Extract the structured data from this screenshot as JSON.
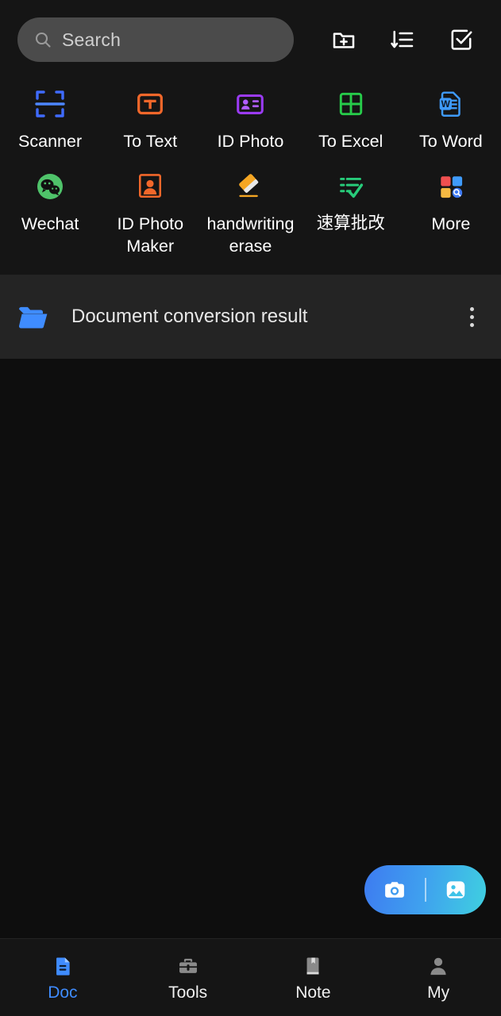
{
  "colors": {
    "background": "#0e0e0e",
    "panel": "#151515",
    "section_bar": "#242424",
    "accent_blue": "#3f8cff",
    "search_field": "#4b4b4b",
    "fab_gradient_start": "#3d7bf0",
    "fab_gradient_end": "#3fd0e0"
  },
  "search": {
    "placeholder": "Search",
    "icon": "search-icon"
  },
  "header": {
    "actions": [
      {
        "name": "new-folder-icon",
        "label": "New folder"
      },
      {
        "name": "sort-list-icon",
        "label": "Sort"
      },
      {
        "name": "select-check-icon",
        "label": "Select"
      }
    ]
  },
  "tools": {
    "row1": [
      {
        "label": "Scanner",
        "icon": "scanner-icon",
        "color": "#3f6bff"
      },
      {
        "label": "To Text",
        "icon": "to-text-icon",
        "color": "#f2672a"
      },
      {
        "label": "ID Photo",
        "icon": "id-photo-icon",
        "color": "#9b3bf5"
      },
      {
        "label": "To Excel",
        "icon": "to-excel-icon",
        "color": "#27cc4a"
      },
      {
        "label": "To Word",
        "icon": "to-word-icon",
        "color": "#3f9bfb"
      }
    ],
    "row2": [
      {
        "label": "Wechat",
        "icon": "wechat-icon",
        "color": "#4fc36a"
      },
      {
        "label": "ID Photo Maker",
        "icon": "id-photo-maker-icon",
        "color": "#f2672a"
      },
      {
        "label": "handwriting erase",
        "icon": "handwriting-erase-icon",
        "color": "#f5a623"
      },
      {
        "label": "速算批改",
        "icon": "homework-check-icon",
        "color": "#27cc7a"
      },
      {
        "label": "More",
        "icon": "more-grid-icon",
        "color": "#f05050"
      }
    ]
  },
  "section": {
    "title": "Document conversion result",
    "folder_icon": "folder-icon",
    "more_icon": "more-vertical-icon"
  },
  "fab": {
    "camera_icon": "camera-icon",
    "gallery_icon": "gallery-image-icon"
  },
  "bottom_nav": {
    "items": [
      {
        "label": "Doc",
        "icon": "document-icon",
        "active": true
      },
      {
        "label": "Tools",
        "icon": "toolbox-icon",
        "active": false
      },
      {
        "label": "Note",
        "icon": "notebook-icon",
        "active": false
      },
      {
        "label": "My",
        "icon": "person-icon",
        "active": false
      }
    ]
  }
}
